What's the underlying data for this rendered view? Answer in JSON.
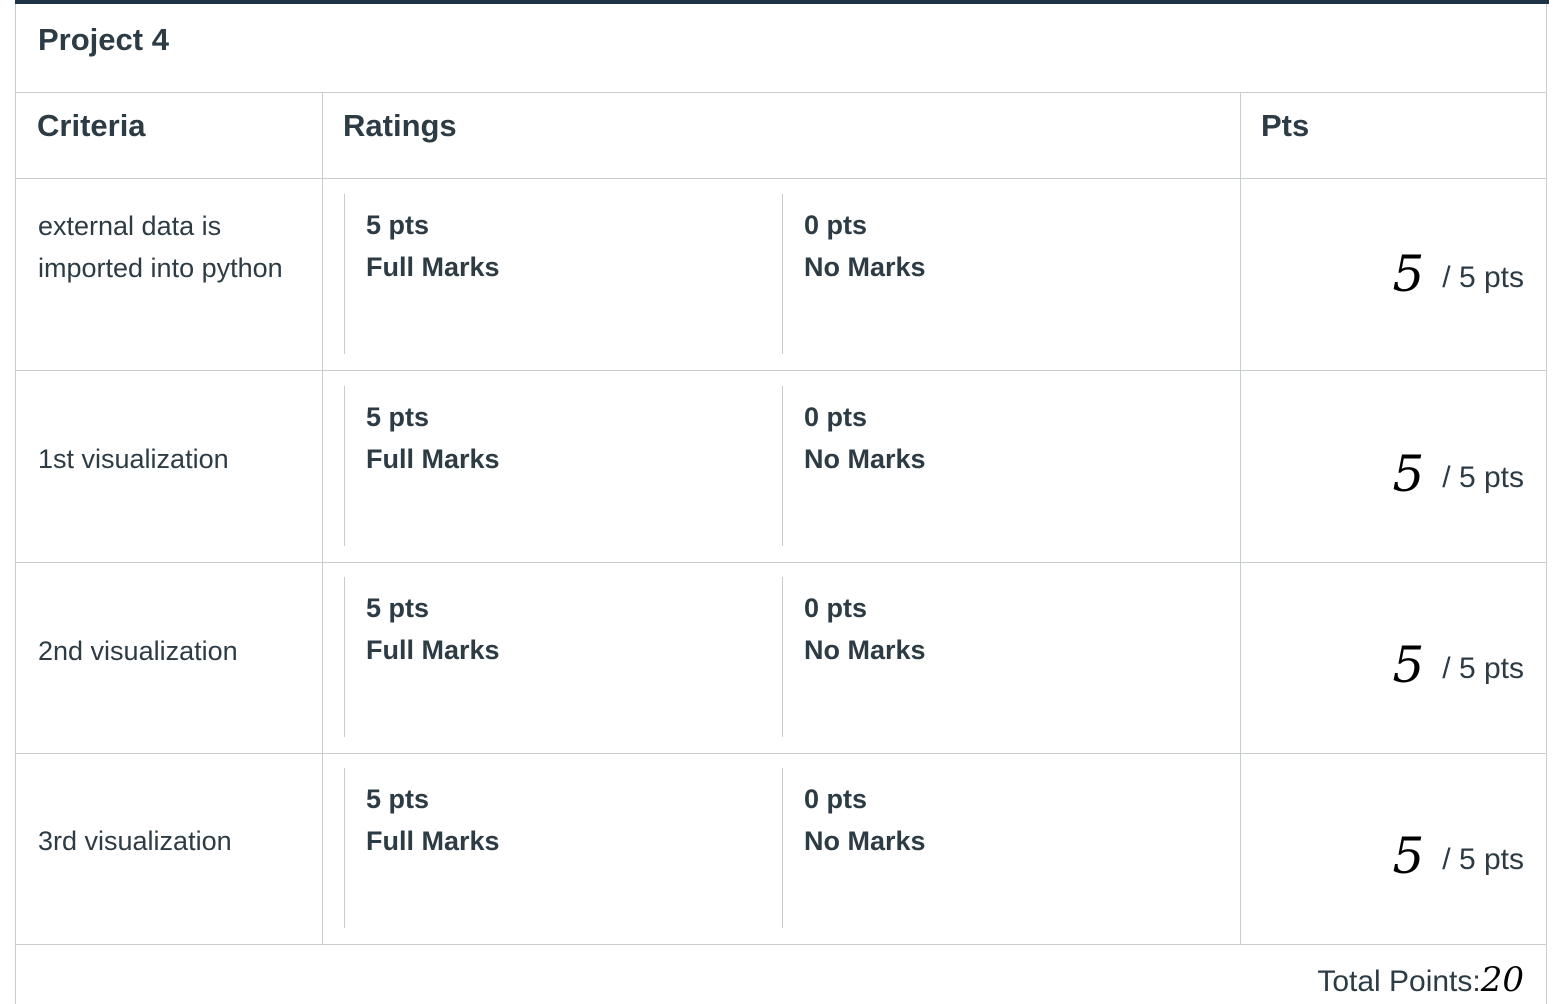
{
  "rubric": {
    "title": "Project 4",
    "headers": {
      "criteria": "Criteria",
      "ratings": "Ratings",
      "pts": "Pts"
    },
    "rows": [
      {
        "criterion": "external data is imported into python",
        "ratings": [
          {
            "pts": "5 pts",
            "label": "Full Marks"
          },
          {
            "pts": "0 pts",
            "label": "No Marks"
          }
        ],
        "score": "5",
        "max": "/ 5 pts"
      },
      {
        "criterion": "1st visualization",
        "ratings": [
          {
            "pts": "5 pts",
            "label": "Full Marks"
          },
          {
            "pts": "0 pts",
            "label": "No Marks"
          }
        ],
        "score": "5",
        "max": "/ 5 pts"
      },
      {
        "criterion": "2nd visualization",
        "ratings": [
          {
            "pts": "5 pts",
            "label": "Full Marks"
          },
          {
            "pts": "0 pts",
            "label": "No Marks"
          }
        ],
        "score": "5",
        "max": "/ 5 pts"
      },
      {
        "criterion": "3rd visualization",
        "ratings": [
          {
            "pts": "5 pts",
            "label": "Full Marks"
          },
          {
            "pts": "0 pts",
            "label": "No Marks"
          }
        ],
        "score": "5",
        "max": "/ 5 pts"
      }
    ],
    "total_label": "Total Points:",
    "total_value": "20"
  }
}
